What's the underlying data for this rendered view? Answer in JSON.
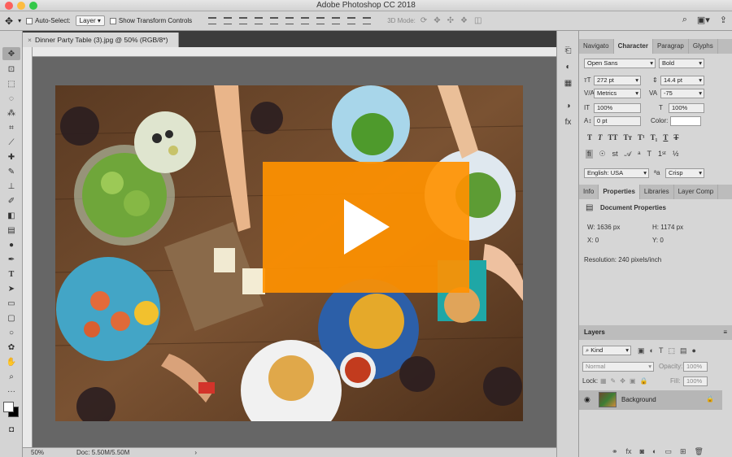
{
  "window": {
    "title": "Adobe Photoshop CC 2018"
  },
  "options_bar": {
    "auto_select_label": "Auto-Select:",
    "auto_select_value": "Layer",
    "show_transform_label": "Show Transform Controls",
    "mode_3d_label": "3D Mode:"
  },
  "document": {
    "tab_title": "Dinner Party Table (3).jpg @ 50% (RGB/8*)",
    "zoom": "50%",
    "doc_size": "Doc: 5.50M/5.50M"
  },
  "character_panel": {
    "tabs": [
      "Navigato",
      "Character",
      "Paragrap",
      "Glyphs"
    ],
    "font_family": "Open Sans",
    "font_style": "Bold",
    "font_size": "272 pt",
    "leading": "14.4 pt",
    "kerning": "Metrics",
    "tracking": "-75",
    "vertical_scale": "100%",
    "horizontal_scale": "100%",
    "baseline_shift": "0 pt",
    "color_label": "Color:",
    "language": "English: USA",
    "anti_alias": "Crisp"
  },
  "properties_panel": {
    "tabs": [
      "Info",
      "Properties",
      "Libraries",
      "Layer Comp"
    ],
    "title": "Document Properties",
    "w": "W: 1636 px",
    "h": "H: 1174 px",
    "x": "X: 0",
    "y": "Y: 0",
    "resolution": "Resolution: 240 pixels/inch"
  },
  "layers_panel": {
    "title": "Layers",
    "filter_kind": "Kind",
    "blend_mode": "Normal",
    "opacity_label": "Opacity:",
    "opacity_value": "100%",
    "lock_label": "Lock:",
    "fill_label": "Fill:",
    "fill_value": "100%",
    "layer_name": "Background"
  },
  "colors": {
    "accent_play": "#ff9100",
    "panel_bg": "#d6d6d6",
    "canvas_bg": "#666666"
  }
}
